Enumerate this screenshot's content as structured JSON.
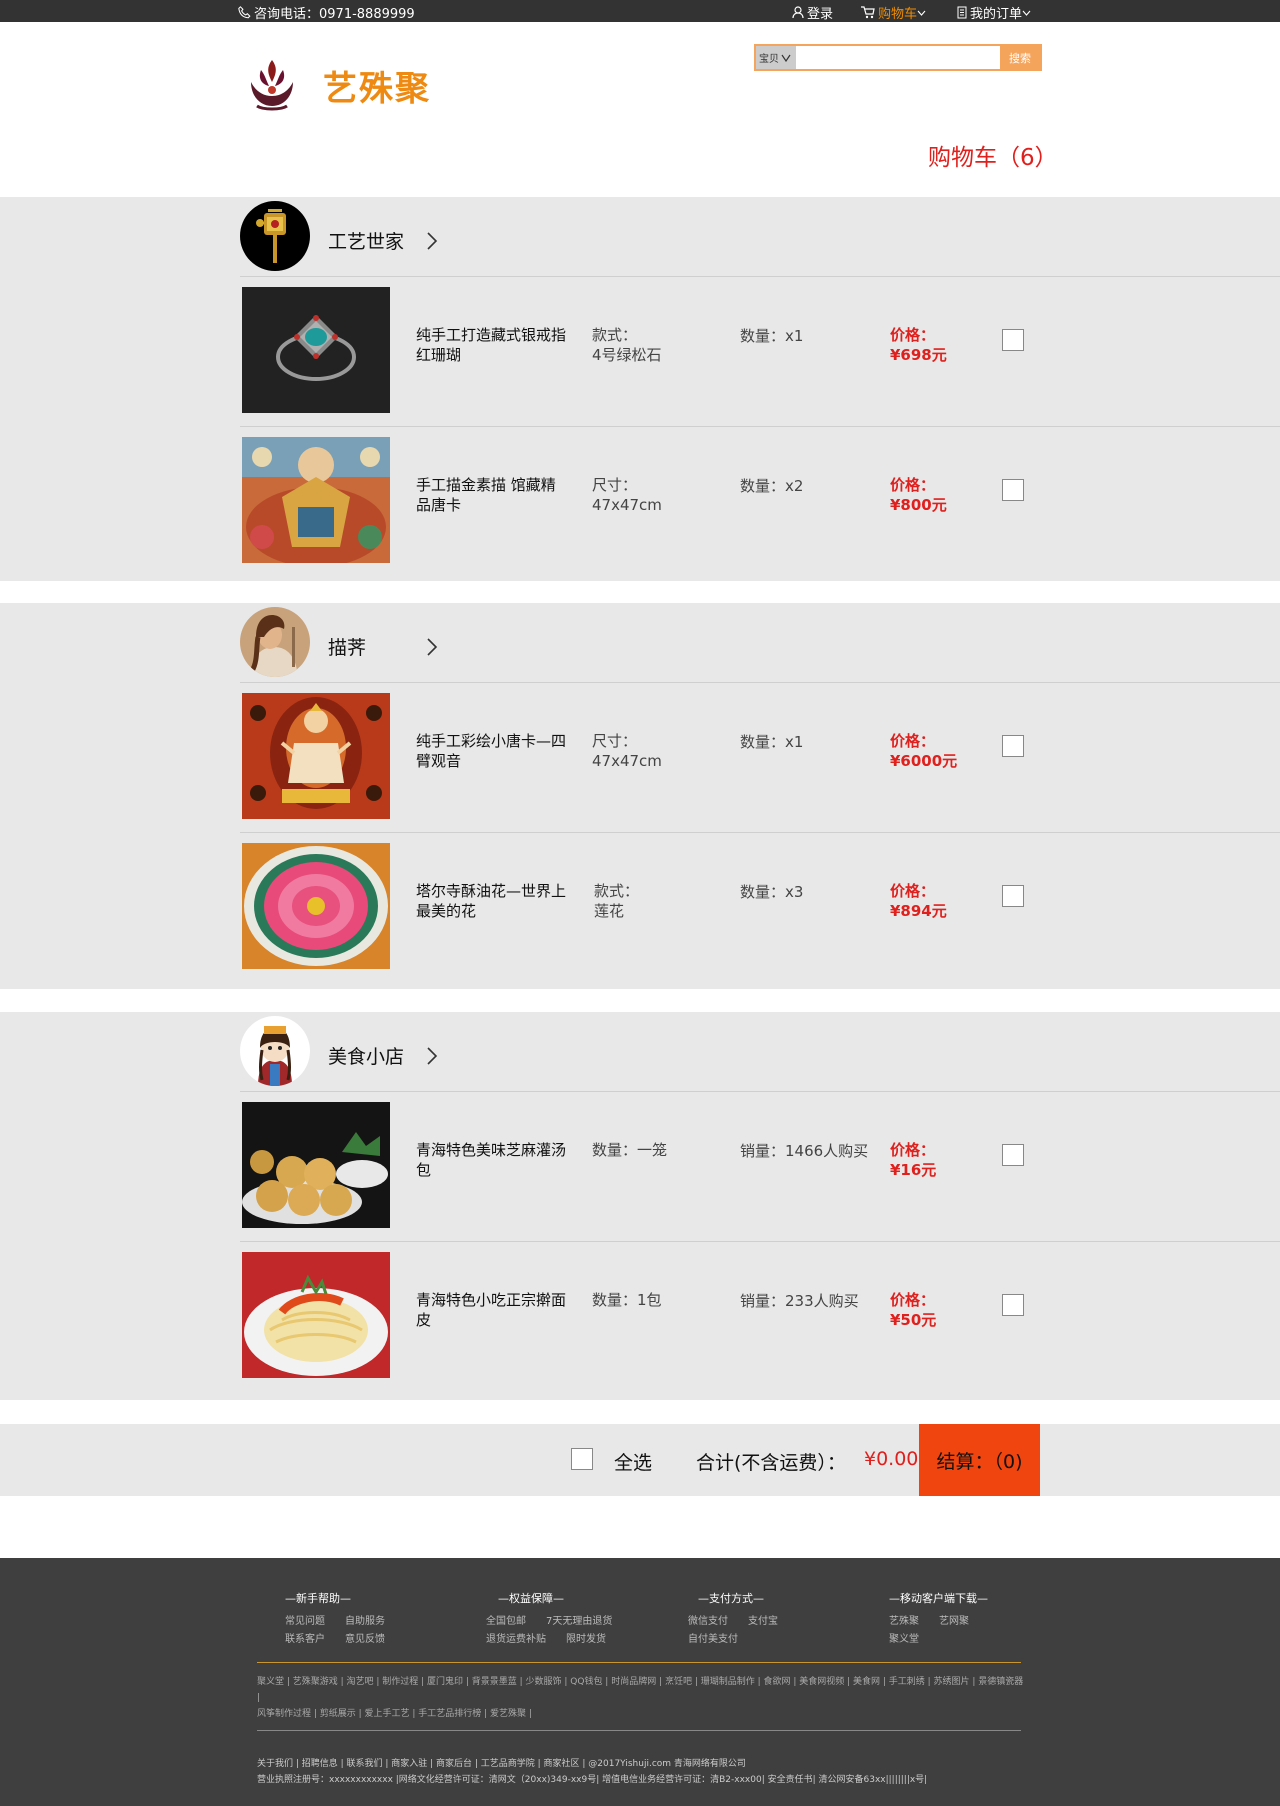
{
  "topbar": {
    "phone": "咨询电话：0971-8889999",
    "login": "登录",
    "cart": "购物车",
    "orders": "我的订单"
  },
  "header": {
    "logo_text": "艺殊聚",
    "search_category": "宝贝",
    "search_value": "",
    "search_button": "搜索",
    "cart_title": "购物车（6）"
  },
  "stores": [
    {
      "name": "工艺世家",
      "items": [
        {
          "name": "纯手工打造藏式银戒指红珊瑚",
          "spec_label": "款式：",
          "spec_value": "4号绿松石",
          "qty": "数量：x1",
          "price_label": "价格：",
          "price": "¥698元"
        },
        {
          "name": "手工描金素描 馆藏精品唐卡",
          "spec_label": "尺寸：",
          "spec_value": "47x47cm",
          "qty": "数量：x2",
          "price_label": "价格：",
          "price": "¥800元"
        }
      ]
    },
    {
      "name": "描荠",
      "items": [
        {
          "name": "纯手工彩绘小唐卡—四臂观音",
          "spec_label": "尺寸：",
          "spec_value": "47x47cm",
          "qty": "数量：x1",
          "price_label": "价格：",
          "price": "¥6000元"
        },
        {
          "name": "塔尔寺酥油花—世界上最美的花",
          "spec_label": "款式：",
          "spec_value": "莲花",
          "qty": "数量：x3",
          "price_label": "价格：",
          "price": "¥894元"
        }
      ]
    },
    {
      "name": "美食小店",
      "items": [
        {
          "name": "青海特色美味芝麻灌汤包",
          "spec_label": "数量：一笼",
          "spec_value": "",
          "qty": "销量：1466人购买",
          "price_label": "价格：",
          "price": "¥16元"
        },
        {
          "name": "青海特色小吃正宗擀面皮",
          "spec_label": "数量：1包",
          "spec_value": "",
          "qty": "销量：233人购买",
          "price_label": "价格：",
          "price": "¥50元"
        }
      ]
    }
  ],
  "totals": {
    "select_all": "全选",
    "sum_label": "合计(不含运费）：",
    "sum_value": "¥0.00",
    "settle": "结算：（0)"
  },
  "footer": {
    "cols": [
      {
        "title": "—新手帮助—",
        "rows": [
          [
            "常见问题",
            "自助服务"
          ],
          [
            "联系客户",
            "意见反馈"
          ]
        ]
      },
      {
        "title": "—权益保障—",
        "rows": [
          [
            "全国包邮",
            "7天无理由退货"
          ],
          [
            "退货运费补贴",
            "限时发货"
          ]
        ]
      },
      {
        "title": "—支付方式—",
        "rows": [
          [
            "微信支付",
            "支付宝"
          ],
          [
            "自付美支付"
          ]
        ]
      },
      {
        "title": "—移动客户端下载—",
        "rows": [
          [
            "艺殊聚",
            "艺网聚"
          ],
          [
            "聚义堂"
          ]
        ]
      }
    ],
    "links_line1": "聚义堂 | 艺殊聚游戏 | 淘艺吧 | 制作过程 | 厦门鬼印 | 背景景墨蓝 | 少数服饰 | QQ钱包 | 时尚品牌网 | 烹饪吧 | 珊瑚制品制作 | 食欲网 | 美食网视频 | 美食网 | 手工刺绣 | 苏绣图片 | 景德镇瓷器 |",
    "links_line2": "风筝制作过程 | 剪纸展示 | 爱上手工艺 | 手工艺品排行榜 | 爱艺殊聚 |",
    "legal_line1": "关于我们 | 招聘信息 | 联系我们 | 商家入驻 | 商家后台 | 工艺品商学院 | 商家社区 | @2017Yishuji.com 青海网络有限公司",
    "legal_line2": "营业执照注册号：xxxxxxxxxxxx |网络文化经营许可证：清网文（20xx)349-xx9号| 增值电信业务经营许可证：清B2-xxx00| 安全责任书| 清公网安备63xx||||||||x号|"
  },
  "colors": {
    "accent": "#ee8a12",
    "price": "#e0201d",
    "settle": "#f0450f",
    "footer": "#3f3f3f"
  }
}
